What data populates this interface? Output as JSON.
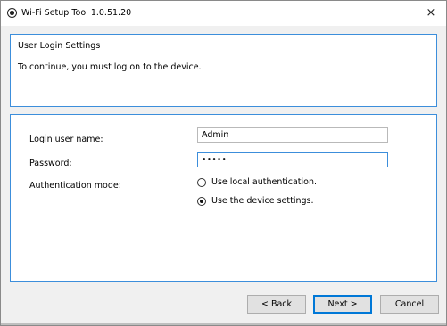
{
  "window": {
    "title": "Wi-Fi Setup Tool 1.0.51.20",
    "icon": "radio-target-icon",
    "close_glyph": "×"
  },
  "header": {
    "title": "User Login Settings",
    "description": "To continue, you must log on to the device."
  },
  "form": {
    "username_label": "Login user name:",
    "username_value": "Admin",
    "password_label": "Password:",
    "password_masked": "•••••",
    "auth_label": "Authentication mode:",
    "auth_options": [
      {
        "label": "Use local authentication.",
        "checked": false
      },
      {
        "label": "Use the device settings.",
        "checked": true
      }
    ]
  },
  "buttons": {
    "back": "< Back",
    "next": "Next >",
    "cancel": "Cancel"
  },
  "colors": {
    "accent": "#3c8edb",
    "window_bg": "#f0f0f0",
    "button_bg": "#e1e1e1"
  }
}
